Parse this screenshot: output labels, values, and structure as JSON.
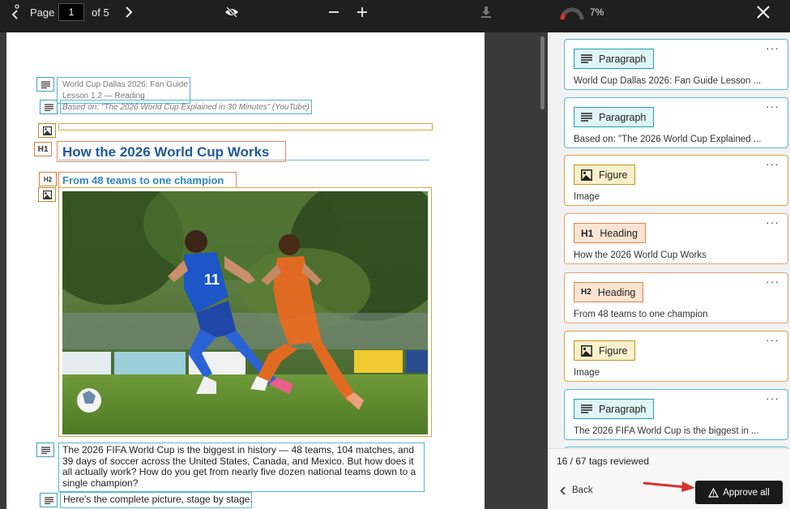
{
  "toolbar": {
    "page_label": "Page",
    "page_value": "1",
    "page_of": "of 5",
    "progress_percent": "7%",
    "progress_fraction": 0.07,
    "icons": [
      "chevron-left-icon",
      "chevron-right-icon",
      "eye-off-icon",
      "zoom-out-icon",
      "zoom-in-icon",
      "download-icon",
      "progress-gauge-icon",
      "close-icon"
    ]
  },
  "document": {
    "para1_line1": "World Cup Dallas 2026: Fan Guide",
    "para1_line2": "Lesson 1.2 — Reading",
    "para2": "Based on: \"The 2026 World Cup Explained in 30 Minutes\" (YouTube)",
    "h1": "How the 2026 World Cup Works",
    "h2": "From 48 teams to one champion",
    "body_para": "The 2026 FIFA World Cup is the biggest in history — 48 teams, 104 matches, and 39 days of soccer across the United States, Canada, and Mexico. But how does it all actually work? How do you get from nearly five dozen national teams down to a single champion?",
    "last_para": "Here's the complete picture, stage by stage.",
    "tag_labels": {
      "h1": "H1",
      "h2": "H2"
    }
  },
  "panel": {
    "cards": [
      {
        "kind": "para",
        "icon": "paragraph-icon",
        "label": "Paragraph",
        "desc": "World Cup Dallas 2026: Fan Guide Lesson ..."
      },
      {
        "kind": "para",
        "icon": "paragraph-icon",
        "label": "Paragraph",
        "desc": "Based on: \"The 2026 World Cup Explained ..."
      },
      {
        "kind": "fig",
        "icon": "figure-icon",
        "label": "Figure",
        "desc": "Image"
      },
      {
        "kind": "h",
        "icon": "H1",
        "label": "Heading",
        "desc": "How the 2026 World Cup Works"
      },
      {
        "kind": "h",
        "icon": "H2",
        "label": "Heading",
        "desc": "From 48 teams to one champion"
      },
      {
        "kind": "fig",
        "icon": "figure-icon",
        "label": "Figure",
        "desc": "Image"
      },
      {
        "kind": "para",
        "icon": "paragraph-icon",
        "label": "Paragraph",
        "desc": "The 2026 FIFA World Cup is the biggest in ..."
      }
    ],
    "menu_dots": "···",
    "reviewed": "16 / 67 tags reviewed",
    "back_label": "Back",
    "approve_label": "Approve all"
  },
  "colors": {
    "paragraph": "#58b8cc",
    "figure": "#d4a843",
    "heading": "#e8895a",
    "accent_arrow": "#d9322e"
  }
}
